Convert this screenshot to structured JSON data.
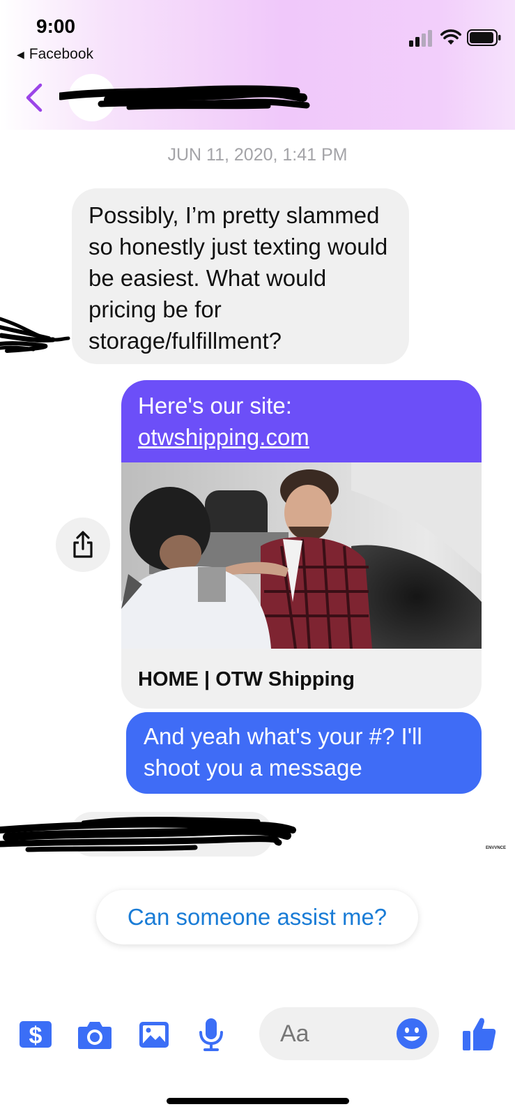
{
  "status_bar": {
    "time": "9:00",
    "back_app_label": "Facebook"
  },
  "header": {
    "back_icon": "chevron-left-icon",
    "contact_name": "",
    "accent_color": "#9b44e8"
  },
  "conversation": {
    "timestamp": "JUN 11, 2020, 1:41 PM",
    "incoming_message": "Possibly, I’m pretty slammed so honestly just texting would be easiest. What would pricing be for storage/fulfillment?",
    "shared_link": {
      "intro_text": "Here's our site:",
      "url_text": "otwshipping.com",
      "preview_title": "HOME | OTW Shipping",
      "bubble_color": "#6c4ff8"
    },
    "outgoing_message": "And yeah what's your #? I'll shoot you a message",
    "outgoing_color": "#3f6cf6",
    "read_receipt_text": "ENVVNCE",
    "share_icon": "share-icon"
  },
  "suggestion": {
    "label": "Can someone assist me?"
  },
  "composer": {
    "placeholder": "Aa",
    "icons": [
      "payment-icon",
      "camera-icon",
      "gallery-icon",
      "microphone-icon",
      "emoji-icon",
      "thumbs-up-icon"
    ],
    "icon_color": "#3b6ef6"
  }
}
